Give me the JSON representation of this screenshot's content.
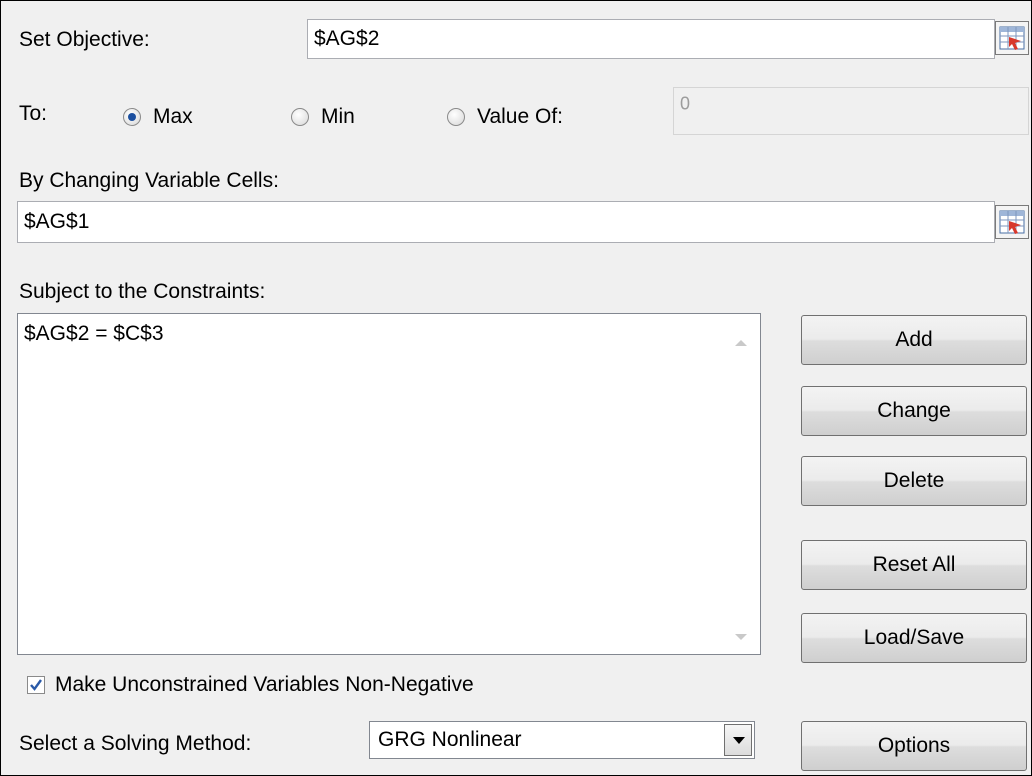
{
  "objective": {
    "label": "Set Objective:",
    "value": "$AG$2"
  },
  "to": {
    "label": "To:",
    "options": [
      {
        "label": "Max",
        "selected": true
      },
      {
        "label": "Min",
        "selected": false
      },
      {
        "label": "Value Of:",
        "selected": false
      }
    ],
    "value_of": "0"
  },
  "variable_cells": {
    "label": "By Changing Variable Cells:",
    "value": "$AG$1"
  },
  "constraints": {
    "label": "Subject to the Constraints:",
    "items": [
      "$AG$2 = $C$3"
    ]
  },
  "buttons": {
    "add": "Add",
    "change": "Change",
    "delete": "Delete",
    "reset_all": "Reset All",
    "load_save": "Load/Save",
    "options": "Options"
  },
  "non_negative": {
    "label": "Make Unconstrained Variables Non-Negative",
    "checked": true
  },
  "solving_method": {
    "label": "Select a Solving Method:",
    "value": "GRG Nonlinear"
  },
  "icons": {
    "ref_edit": "range-selector-icon",
    "dropdown": "chevron-down-icon",
    "check": "check-icon"
  },
  "colors": {
    "dialog_bg": "#f0f0f0",
    "radio_dot": "#1b4f9f",
    "check_mark": "#2a5aa8"
  }
}
